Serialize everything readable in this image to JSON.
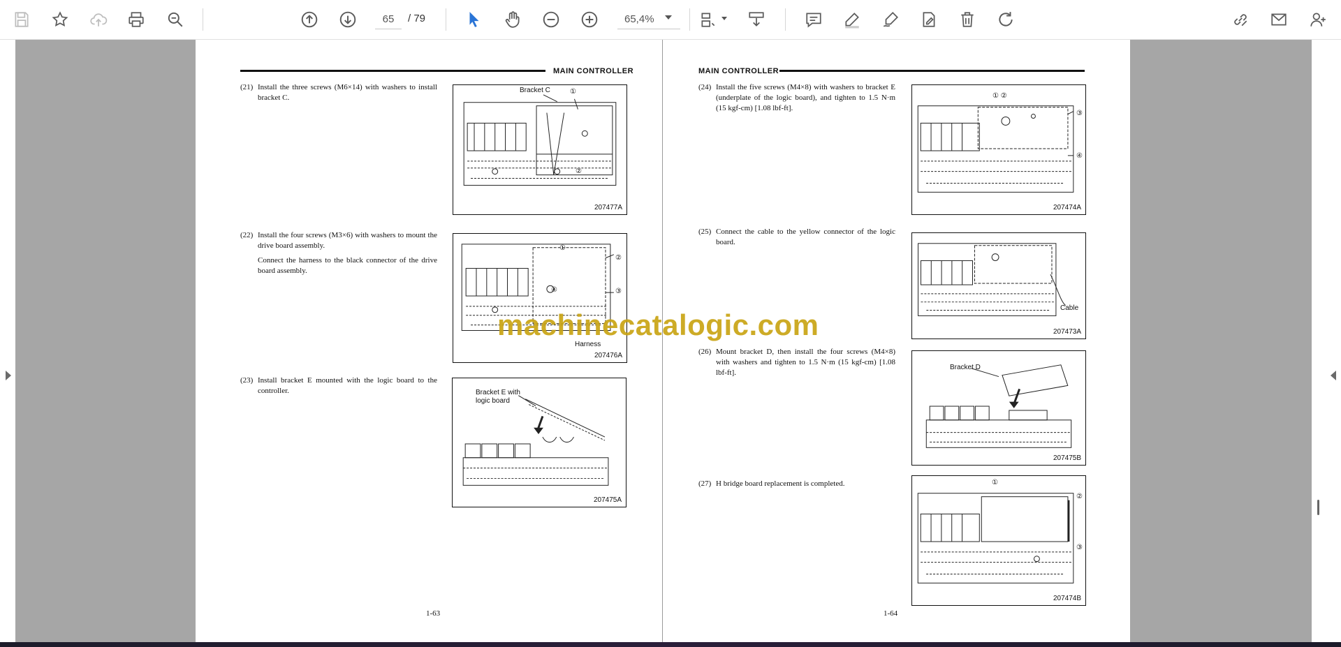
{
  "toolbar": {
    "icons": [
      "save-icon",
      "bookmark-star-icon",
      "cloud-upload-icon",
      "print-icon",
      "search-zoom-icon",
      "page-up-icon",
      "page-down-icon",
      "select-cursor-icon",
      "hand-pan-icon",
      "zoom-out-icon",
      "zoom-in-icon",
      "fit-page-icon",
      "scroll-mode-icon",
      "comment-icon",
      "highlight-pen-icon",
      "draw-sign-icon",
      "edit-stamp-icon",
      "delete-icon",
      "rotate-icon",
      "share-link-icon",
      "email-icon",
      "add-user-icon"
    ],
    "page_current": "65",
    "page_total": "/ 79",
    "zoom": "65,4%"
  },
  "watermark": "machinecatalogic.com",
  "left_page": {
    "header": "MAIN  CONTROLLER",
    "page_number": "1-63",
    "steps": [
      {
        "num": "(21)",
        "text": "Install the three screws (M6×14) with washers to install bracket C.",
        "text2": ""
      },
      {
        "num": "(22)",
        "text": "Install the four screws (M3×6) with washers to mount the drive board assembly.",
        "text2": "Connect the harness to the black connector of the drive board assembly."
      },
      {
        "num": "(23)",
        "text": "Install bracket E mounted with the logic board to the controller.",
        "text2": ""
      }
    ],
    "figures": [
      {
        "code": "207477A",
        "labels": [
          "Bracket C",
          "①",
          "②"
        ]
      },
      {
        "code": "207476A",
        "labels": [
          "①",
          "②",
          "③",
          "④",
          "Harness"
        ]
      },
      {
        "code": "207475A",
        "labels": [
          "Bracket E with",
          "logic board"
        ]
      }
    ]
  },
  "right_page": {
    "header": "MAIN  CONTROLLER",
    "page_number": "1-64",
    "steps": [
      {
        "num": "(24)",
        "text": "Install the five screws (M4×8) with washers to bracket E (underplate of the logic board), and tighten to 1.5 N·m (15 kgf-cm) [1.08 lbf-ft].",
        "text2": ""
      },
      {
        "num": "(25)",
        "text": "Connect the cable to the yellow connector of the logic board.",
        "text2": ""
      },
      {
        "num": "(26)",
        "text": "Mount bracket D, then install the four screws (M4×8) with washers and tighten to 1.5 N·m (15 kgf-cm) [1.08 lbf-ft].",
        "text2": ""
      },
      {
        "num": "(27)",
        "text": "H bridge board replacement is completed.",
        "text2": ""
      }
    ],
    "figures": [
      {
        "code": "207474A",
        "labels": [
          "① ②",
          "③",
          "④"
        ]
      },
      {
        "code": "207473A",
        "labels": [
          "Cable"
        ]
      },
      {
        "code": "207475B",
        "labels": [
          "Bracket D"
        ]
      },
      {
        "code": "207474B",
        "labels": [
          "①",
          "②",
          "③"
        ]
      }
    ]
  }
}
